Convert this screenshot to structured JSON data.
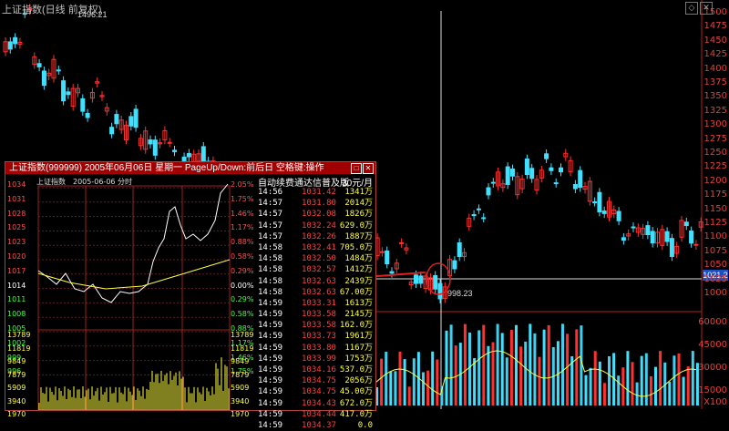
{
  "window_title": "上证指数(日线 前复权)",
  "high_label": "1496.21",
  "low_label": "998.23",
  "current_price": "1021.2",
  "right_axis": [
    "1500",
    "1475",
    "1450",
    "1425",
    "1400",
    "1375",
    "1350",
    "1325",
    "1300",
    "1275",
    "1250",
    "1225",
    "1200",
    "1175",
    "1150",
    "1125",
    "1100",
    "1075",
    "1050",
    "1025",
    "1000"
  ],
  "volume_axis": [
    "60000",
    "45000",
    "30000",
    "15000",
    "X100"
  ],
  "colors": {
    "up": "#ff3030",
    "down": "#40e0ff",
    "ma": "#ffff40",
    "popup_title": "#a00000"
  },
  "popup": {
    "title": "上证指数(999999) 2005年06月06日 星期一 PageUp/Down:前后日 空格键:操作",
    "minute_label": "上证指数",
    "minute_date": "2005-06-06 分时",
    "left_axis": [
      "1034",
      "1031",
      "1028",
      "1025",
      "1023",
      "1020",
      "1017",
      "1014",
      "1011",
      "1008",
      "1005",
      "1002",
      "999",
      "996"
    ],
    "right_axis": [
      "2.05%",
      "1.75%",
      "1.46%",
      "1.17%",
      "0.88%",
      "0.58%",
      "0.29%",
      "0.00%",
      "0.29%",
      "0.58%",
      "0.88%",
      "1.17%",
      "1.46%",
      "1.75%"
    ],
    "vol_axis": [
      "13789",
      "11819",
      "9849",
      "7879",
      "5909",
      "3940",
      "1970"
    ],
    "ticks_header": "自动续费通达信普及版",
    "ticks_unit": "30元/月",
    "ticks": [
      {
        "t": "14:56",
        "p": "1031.42",
        "v": "1341万"
      },
      {
        "t": "14:57",
        "p": "1031.80",
        "v": "2014万"
      },
      {
        "t": "14:57",
        "p": "1032.08",
        "v": "1826万"
      },
      {
        "t": "14:57",
        "p": "1032.24",
        "v": "629.0万"
      },
      {
        "t": "14:57",
        "p": "1032.26",
        "v": "1887万"
      },
      {
        "t": "14:58",
        "p": "1032.41",
        "v": "705.0万"
      },
      {
        "t": "14:58",
        "p": "1032.50",
        "v": "1484万"
      },
      {
        "t": "14:58",
        "p": "1032.57",
        "v": "1412万"
      },
      {
        "t": "14:58",
        "p": "1032.63",
        "v": "2439万"
      },
      {
        "t": "14:58",
        "p": "1032.63",
        "v": "67.00万"
      },
      {
        "t": "14:59",
        "p": "1033.31",
        "v": "1613万"
      },
      {
        "t": "14:59",
        "p": "1033.58",
        "v": "2145万"
      },
      {
        "t": "14:59",
        "p": "1033.58",
        "v": "162.0万"
      },
      {
        "t": "14:59",
        "p": "1033.73",
        "v": "1961万"
      },
      {
        "t": "14:59",
        "p": "1033.80",
        "v": "1167万"
      },
      {
        "t": "14:59",
        "p": "1033.99",
        "v": "1753万"
      },
      {
        "t": "14:59",
        "p": "1034.16",
        "v": "537.0万"
      },
      {
        "t": "14:59",
        "p": "1034.75",
        "v": "2056万"
      },
      {
        "t": "14:59",
        "p": "1034.75",
        "v": "45.00万"
      },
      {
        "t": "14:59",
        "p": "1034.43",
        "v": "672.0万"
      },
      {
        "t": "14:59",
        "p": "1034.44",
        "v": "417.0万"
      },
      {
        "t": "14:59",
        "p": "1034.37",
        "v": "0.0"
      }
    ]
  }
}
